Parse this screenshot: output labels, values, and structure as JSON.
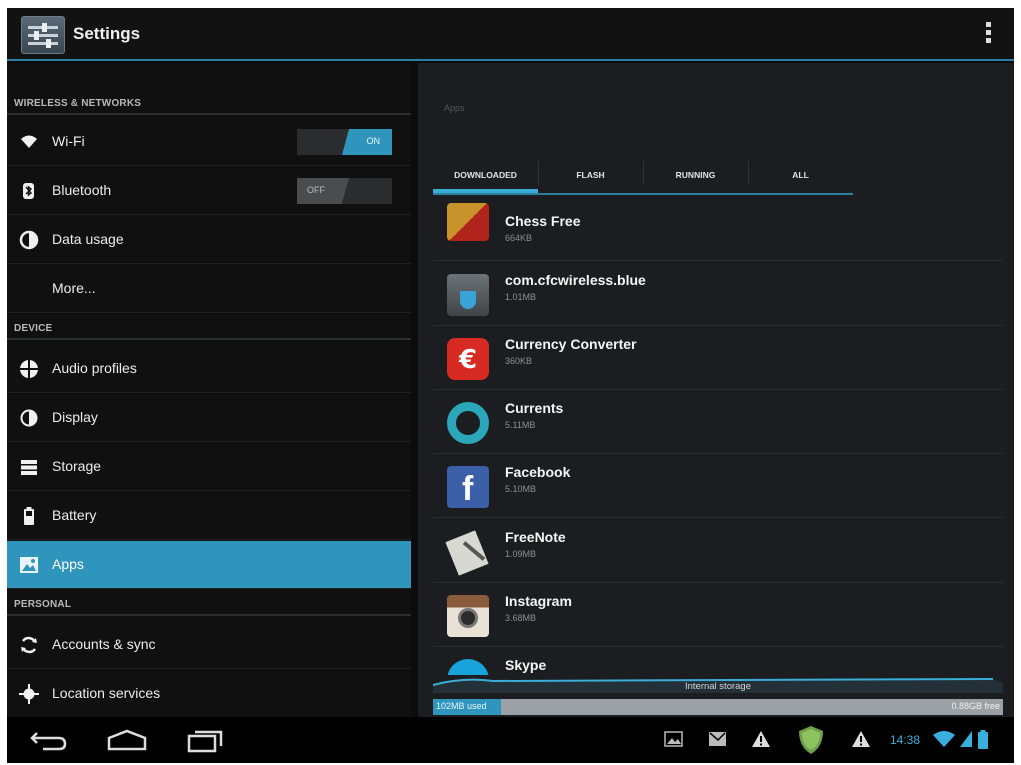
{
  "action_bar": {
    "title": "Settings"
  },
  "sidebar": {
    "sections": [
      {
        "label": "WIRELESS & NETWORKS"
      },
      {
        "label": "DEVICE"
      },
      {
        "label": "PERSONAL"
      }
    ],
    "items": [
      {
        "label": "Wi-Fi",
        "icon": "wifi-icon",
        "toggle": "ON"
      },
      {
        "label": "Bluetooth",
        "icon": "bluetooth-icon",
        "toggle": "OFF"
      },
      {
        "label": "Data usage",
        "icon": "data-usage-icon"
      },
      {
        "label": "More..."
      },
      {
        "label": "Audio profiles",
        "icon": "audio-profiles-icon"
      },
      {
        "label": "Display",
        "icon": "display-icon"
      },
      {
        "label": "Storage",
        "icon": "storage-icon"
      },
      {
        "label": "Battery",
        "icon": "battery-icon"
      },
      {
        "label": "Apps",
        "icon": "apps-icon",
        "selected": true
      },
      {
        "label": "Accounts & sync",
        "icon": "sync-icon"
      },
      {
        "label": "Location services",
        "icon": "location-icon"
      }
    ]
  },
  "apps_panel": {
    "title": "Apps",
    "tabs": [
      {
        "label": "DOWNLOADED",
        "active": true
      },
      {
        "label": "FLASH"
      },
      {
        "label": "RUNNING"
      },
      {
        "label": "ALL"
      }
    ],
    "apps": [
      {
        "name": "Chess Free",
        "size": "664KB",
        "icon": "chess-icon"
      },
      {
        "name": "com.cfcwireless.blue",
        "size": "1.01MB",
        "icon": "cfcwireless-icon"
      },
      {
        "name": "Currency Converter",
        "size": "360KB",
        "icon": "euro-icon"
      },
      {
        "name": "Currents",
        "size": "5.11MB",
        "icon": "currents-icon"
      },
      {
        "name": "Facebook",
        "size": "5.10MB",
        "icon": "facebook-icon"
      },
      {
        "name": "FreeNote",
        "size": "1.09MB",
        "icon": "freenote-icon"
      },
      {
        "name": "Instagram",
        "size": "3.68MB",
        "icon": "instagram-icon"
      },
      {
        "name": "Skype",
        "size": "",
        "icon": "skype-icon"
      }
    ],
    "storage": {
      "label": "Internal storage",
      "used": "102MB used",
      "free": "0.88GB free",
      "used_fraction": 0.12
    }
  },
  "status_bar": {
    "time": "14:38"
  },
  "colors": {
    "accent": "#2f95bd",
    "background": "#0c0c0c"
  }
}
